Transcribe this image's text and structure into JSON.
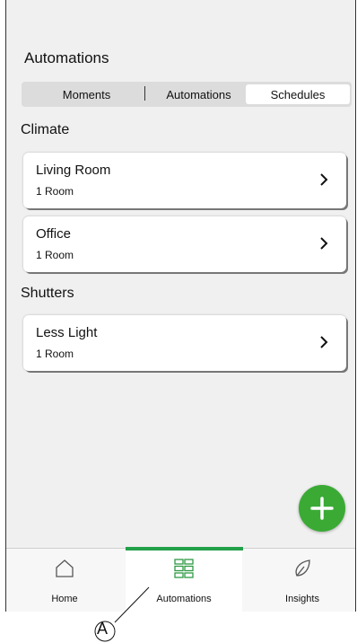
{
  "header": {
    "title": "Automations"
  },
  "tabs": [
    {
      "label": "Moments",
      "selected": false
    },
    {
      "label": "Automations",
      "selected": false
    },
    {
      "label": "Schedules",
      "selected": true
    }
  ],
  "sections": [
    {
      "title": "Climate",
      "items": [
        {
          "name": "Living Room",
          "detail": "1 Room"
        },
        {
          "name": "Office",
          "detail": "1 Room"
        }
      ]
    },
    {
      "title": "Shutters",
      "items": [
        {
          "name": "Less Light",
          "detail": "1 Room"
        }
      ]
    }
  ],
  "nav": [
    {
      "label": "Home",
      "icon": "home-icon",
      "active": false
    },
    {
      "label": "Automations",
      "icon": "grid-icon",
      "active": true
    },
    {
      "label": "Insights",
      "icon": "leaf-icon",
      "active": false
    }
  ],
  "callout": {
    "letter": "A"
  },
  "colors": {
    "accent": "#3aaa35",
    "active_bar": "#22a04a"
  }
}
